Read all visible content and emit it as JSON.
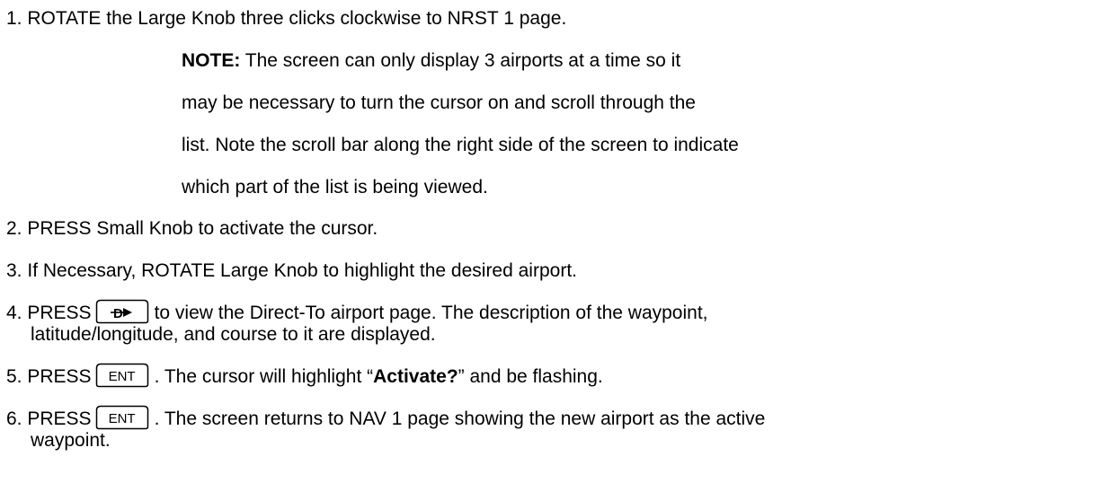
{
  "steps": [
    {
      "number": "1.",
      "text": "ROTATE the Large Knob three clicks clockwise to NRST 1 page."
    },
    {
      "number": "2.",
      "text": "PRESS Small Knob to activate the cursor."
    },
    {
      "number": "3.",
      "text": "If Necessary, ROTATE Large Knob to highlight the desired airport."
    },
    {
      "number": "4.",
      "pre": "PRESS",
      "post": "to view the Direct-To airport page. The description of the waypoint,",
      "cont": "latitude/longitude, and course to it are displayed."
    },
    {
      "number": "5.",
      "pre": "PRESS",
      "post_a": ". The cursor will highlight “",
      "bold": "Activate?",
      "post_b": "” and be flashing."
    },
    {
      "number": "6.",
      "pre": "PRESS",
      "post": ". The screen returns to NAV 1 page showing the new airport as the active",
      "cont": "waypoint."
    }
  ],
  "note": {
    "label": "NOTE:",
    "lines": [
      " The screen can only display 3 airports at a time so it",
      "may be necessary to turn the cursor on and scroll through the",
      "list. Note the scroll bar along the right side of the screen to indicate",
      "which part of the list is being viewed."
    ]
  },
  "keys": {
    "direct_to": "direct-to-key",
    "enter_label": "ENT"
  }
}
